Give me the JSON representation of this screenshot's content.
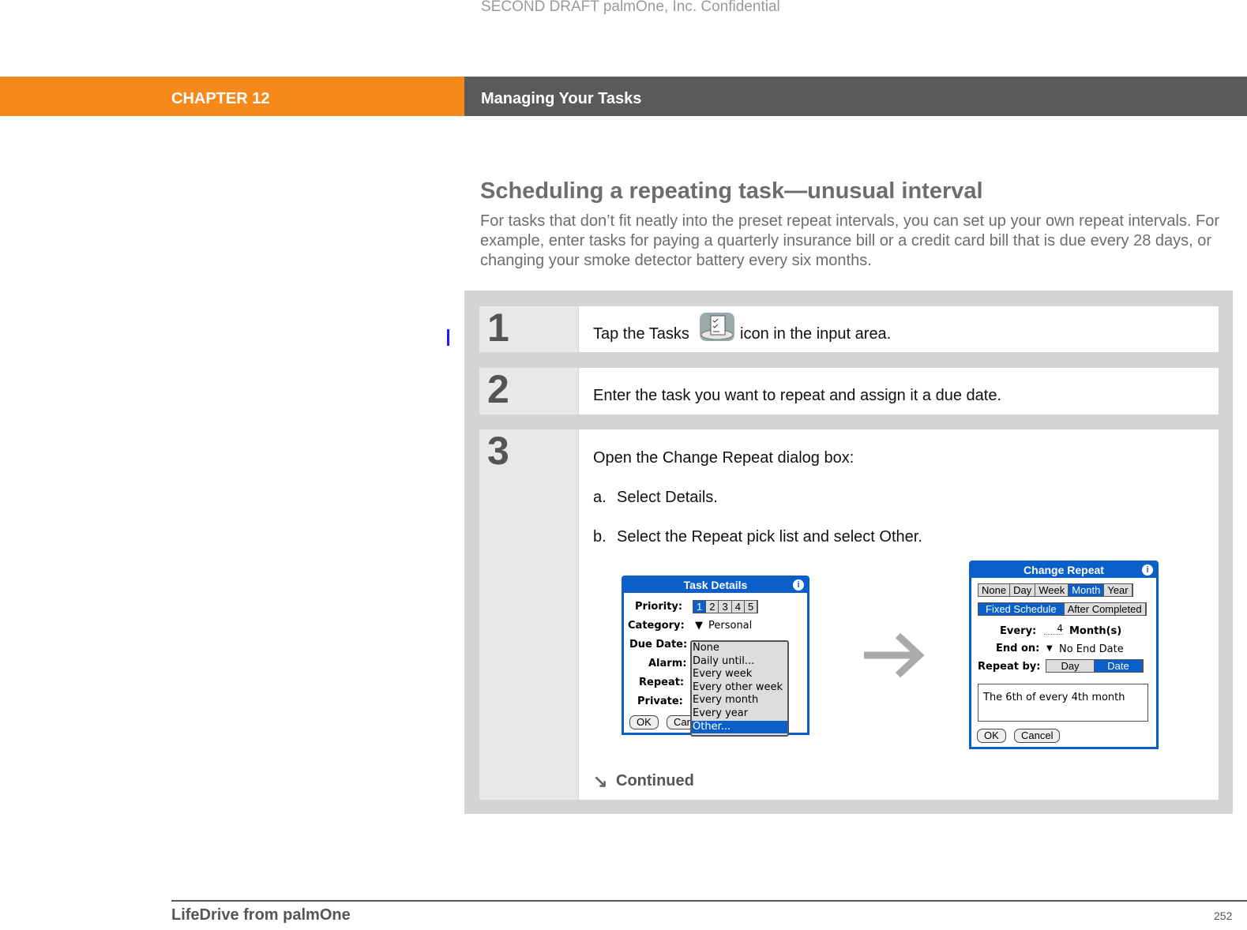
{
  "watermark": "SECOND DRAFT palmOne, Inc.  Confidential",
  "header": {
    "chapter": "CHAPTER 12",
    "title": "Managing Your Tasks",
    "colors": {
      "chapter_bg": "#f7891b",
      "title_bg": "#5a5a5a"
    }
  },
  "section": {
    "title": "Scheduling a repeating task—unusual interval",
    "intro": "For tasks that don’t fit neatly into the preset repeat intervals, you can set up your own repeat intervals. For example, enter tasks for paying a quarterly insurance bill or a credit card bill that is due every 28 days, or changing your smoke detector battery every six months."
  },
  "steps": [
    {
      "number": "1",
      "text_before": "Tap the Tasks",
      "icon": "tasks-icon",
      "text_after": "icon in the input area."
    },
    {
      "number": "2",
      "text": "Enter the task you want to repeat and assign it a due date."
    },
    {
      "number": "3",
      "text": "Open the Change Repeat dialog box:",
      "substeps": [
        {
          "marker": "a.",
          "text": "Select Details."
        },
        {
          "marker": "b.",
          "text": "Select the Repeat pick list and select Other."
        }
      ],
      "continued": "Continued"
    }
  ],
  "task_details": {
    "title": "Task Details",
    "priority_label": "Priority:",
    "priorities": [
      "1",
      "2",
      "3",
      "4",
      "5"
    ],
    "category_label": "Category:",
    "category": "Personal",
    "due_label": "Due Date:",
    "alarm_label": "Alarm:",
    "repeat_label": "Repeat:",
    "private_label": "Private:",
    "ok": "OK",
    "cancel": "Can",
    "repeat_options": [
      "None",
      "Daily until...",
      "Every week",
      "Every other week",
      "Every month",
      "Every year",
      "Other..."
    ],
    "selected_option": "Other..."
  },
  "change_repeat": {
    "title": "Change Repeat",
    "tabs": [
      "None",
      "Day",
      "Week",
      "Month",
      "Year"
    ],
    "selected_tab": "Month",
    "modes": [
      "Fixed Schedule",
      "After Completed"
    ],
    "every_label": "Every:",
    "every_value": "4",
    "every_unit": "Month(s)",
    "end_label": "End on:",
    "end_value": "No End Date",
    "repeat_by_label": "Repeat by:",
    "repeat_by": [
      "Day",
      "Date"
    ],
    "summary": "The 6th of every 4th month",
    "ok": "OK",
    "cancel": "Cancel"
  },
  "footer": {
    "left": "LifeDrive from palmOne",
    "page": "252"
  }
}
